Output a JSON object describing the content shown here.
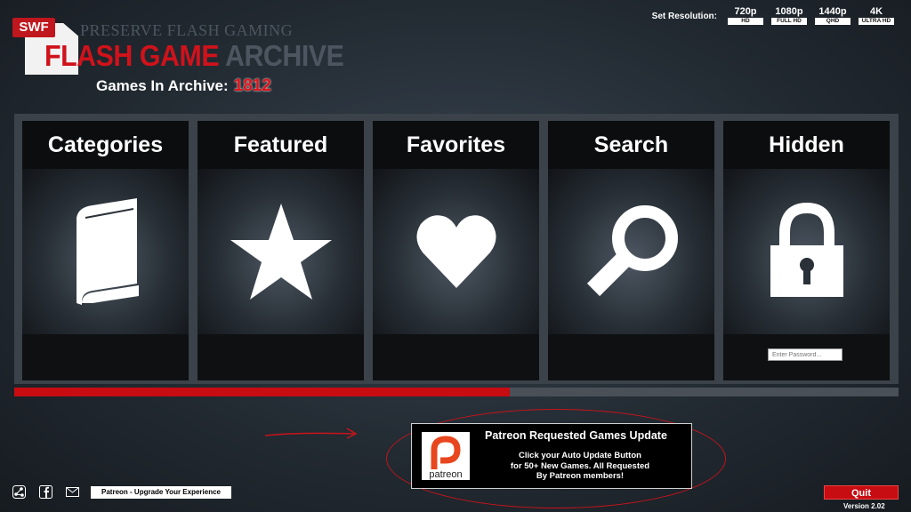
{
  "logo": {
    "badge": "SWF",
    "tagline": "PRESERVE FLASH GAMING",
    "title_red": "FLASH GAME",
    "title_grey": "ARCHIVE"
  },
  "archive": {
    "label": "Games In Archive:",
    "count": "1812"
  },
  "resolution": {
    "label": "Set Resolution:",
    "options": [
      {
        "value": "720p",
        "tag": "HD"
      },
      {
        "value": "1080p",
        "tag": "FULL HD"
      },
      {
        "value": "1440p",
        "tag": "QHD"
      },
      {
        "value": "4K",
        "tag": "ULTRA HD"
      }
    ]
  },
  "menu": {
    "tiles": [
      {
        "label": "Categories",
        "icon": "book-icon"
      },
      {
        "label": "Featured",
        "icon": "star-icon"
      },
      {
        "label": "Favorites",
        "icon": "heart-icon"
      },
      {
        "label": "Search",
        "icon": "magnifier-icon"
      },
      {
        "label": "Hidden",
        "icon": "padlock-icon"
      }
    ],
    "password_placeholder": "Enter Password..."
  },
  "progress": {
    "value_percent": 56
  },
  "patreon": {
    "logo_text": "patreon",
    "title": "Patreon Requested Games Update",
    "message": [
      "Click your Auto Update Button",
      "for 50+ New Games. All Requested",
      "By Patreon members!"
    ]
  },
  "footer": {
    "social_icons": [
      "share-icon",
      "facebook-icon",
      "email-icon"
    ],
    "upgrade_label": "Patreon - Upgrade Your Experience",
    "quit_label": "Quit",
    "version": "Version 2.02"
  },
  "colors": {
    "accent_red": "#c70c12",
    "panel": "#3b4249",
    "background": "#232b33"
  }
}
